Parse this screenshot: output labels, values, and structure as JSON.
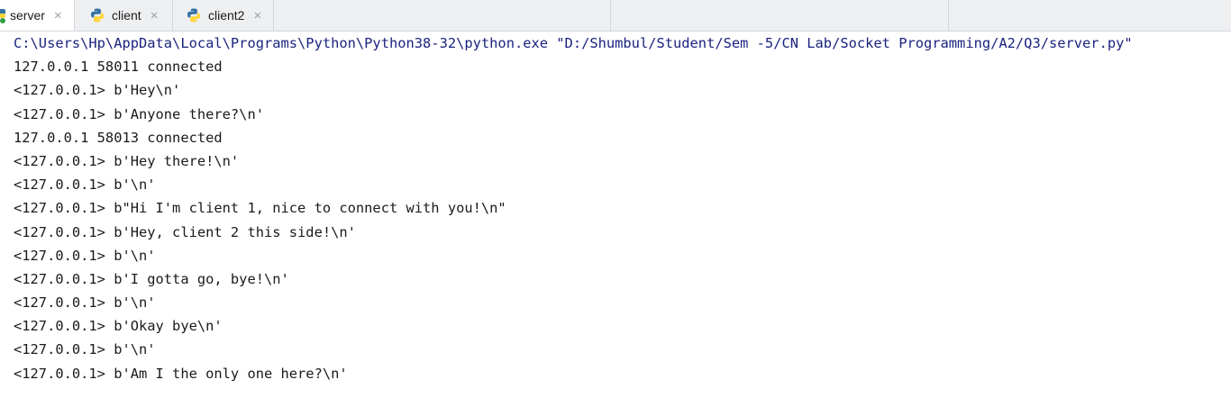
{
  "tabs": [
    {
      "label": "server",
      "active": true,
      "icon": "python-run-icon"
    },
    {
      "label": "client",
      "active": false,
      "icon": "python-icon"
    },
    {
      "label": "client2",
      "active": false,
      "icon": "python-icon"
    }
  ],
  "tab_close_glyph": "×",
  "colors": {
    "command": "#1a237e",
    "output": "#1a1a1a",
    "tabbar_bg": "#eeeff1",
    "python_blue": "#3572A5",
    "python_yellow": "#FFD43B",
    "run_green": "#2e9e44"
  },
  "console": {
    "command": "C:\\Users\\Hp\\AppData\\Local\\Programs\\Python\\Python38-32\\python.exe \"D:/Shumbul/Student/Sem -5/CN Lab/Socket Programming/A2/Q3/server.py\"",
    "lines": [
      "127.0.0.1 58011 connected",
      "<127.0.0.1> b'Hey\\n'",
      "<127.0.0.1> b'Anyone there?\\n'",
      "127.0.0.1 58013 connected",
      "<127.0.0.1> b'Hey there!\\n'",
      "<127.0.0.1> b'\\n'",
      "<127.0.0.1> b\"Hi I'm client 1, nice to connect with you!\\n\"",
      "<127.0.0.1> b'Hey, client 2 this side!\\n'",
      "<127.0.0.1> b'\\n'",
      "<127.0.0.1> b'I gotta go, bye!\\n'",
      "<127.0.0.1> b'\\n'",
      "<127.0.0.1> b'Okay bye\\n'",
      "<127.0.0.1> b'\\n'",
      "<127.0.0.1> b'Am I the only one here?\\n'"
    ]
  }
}
